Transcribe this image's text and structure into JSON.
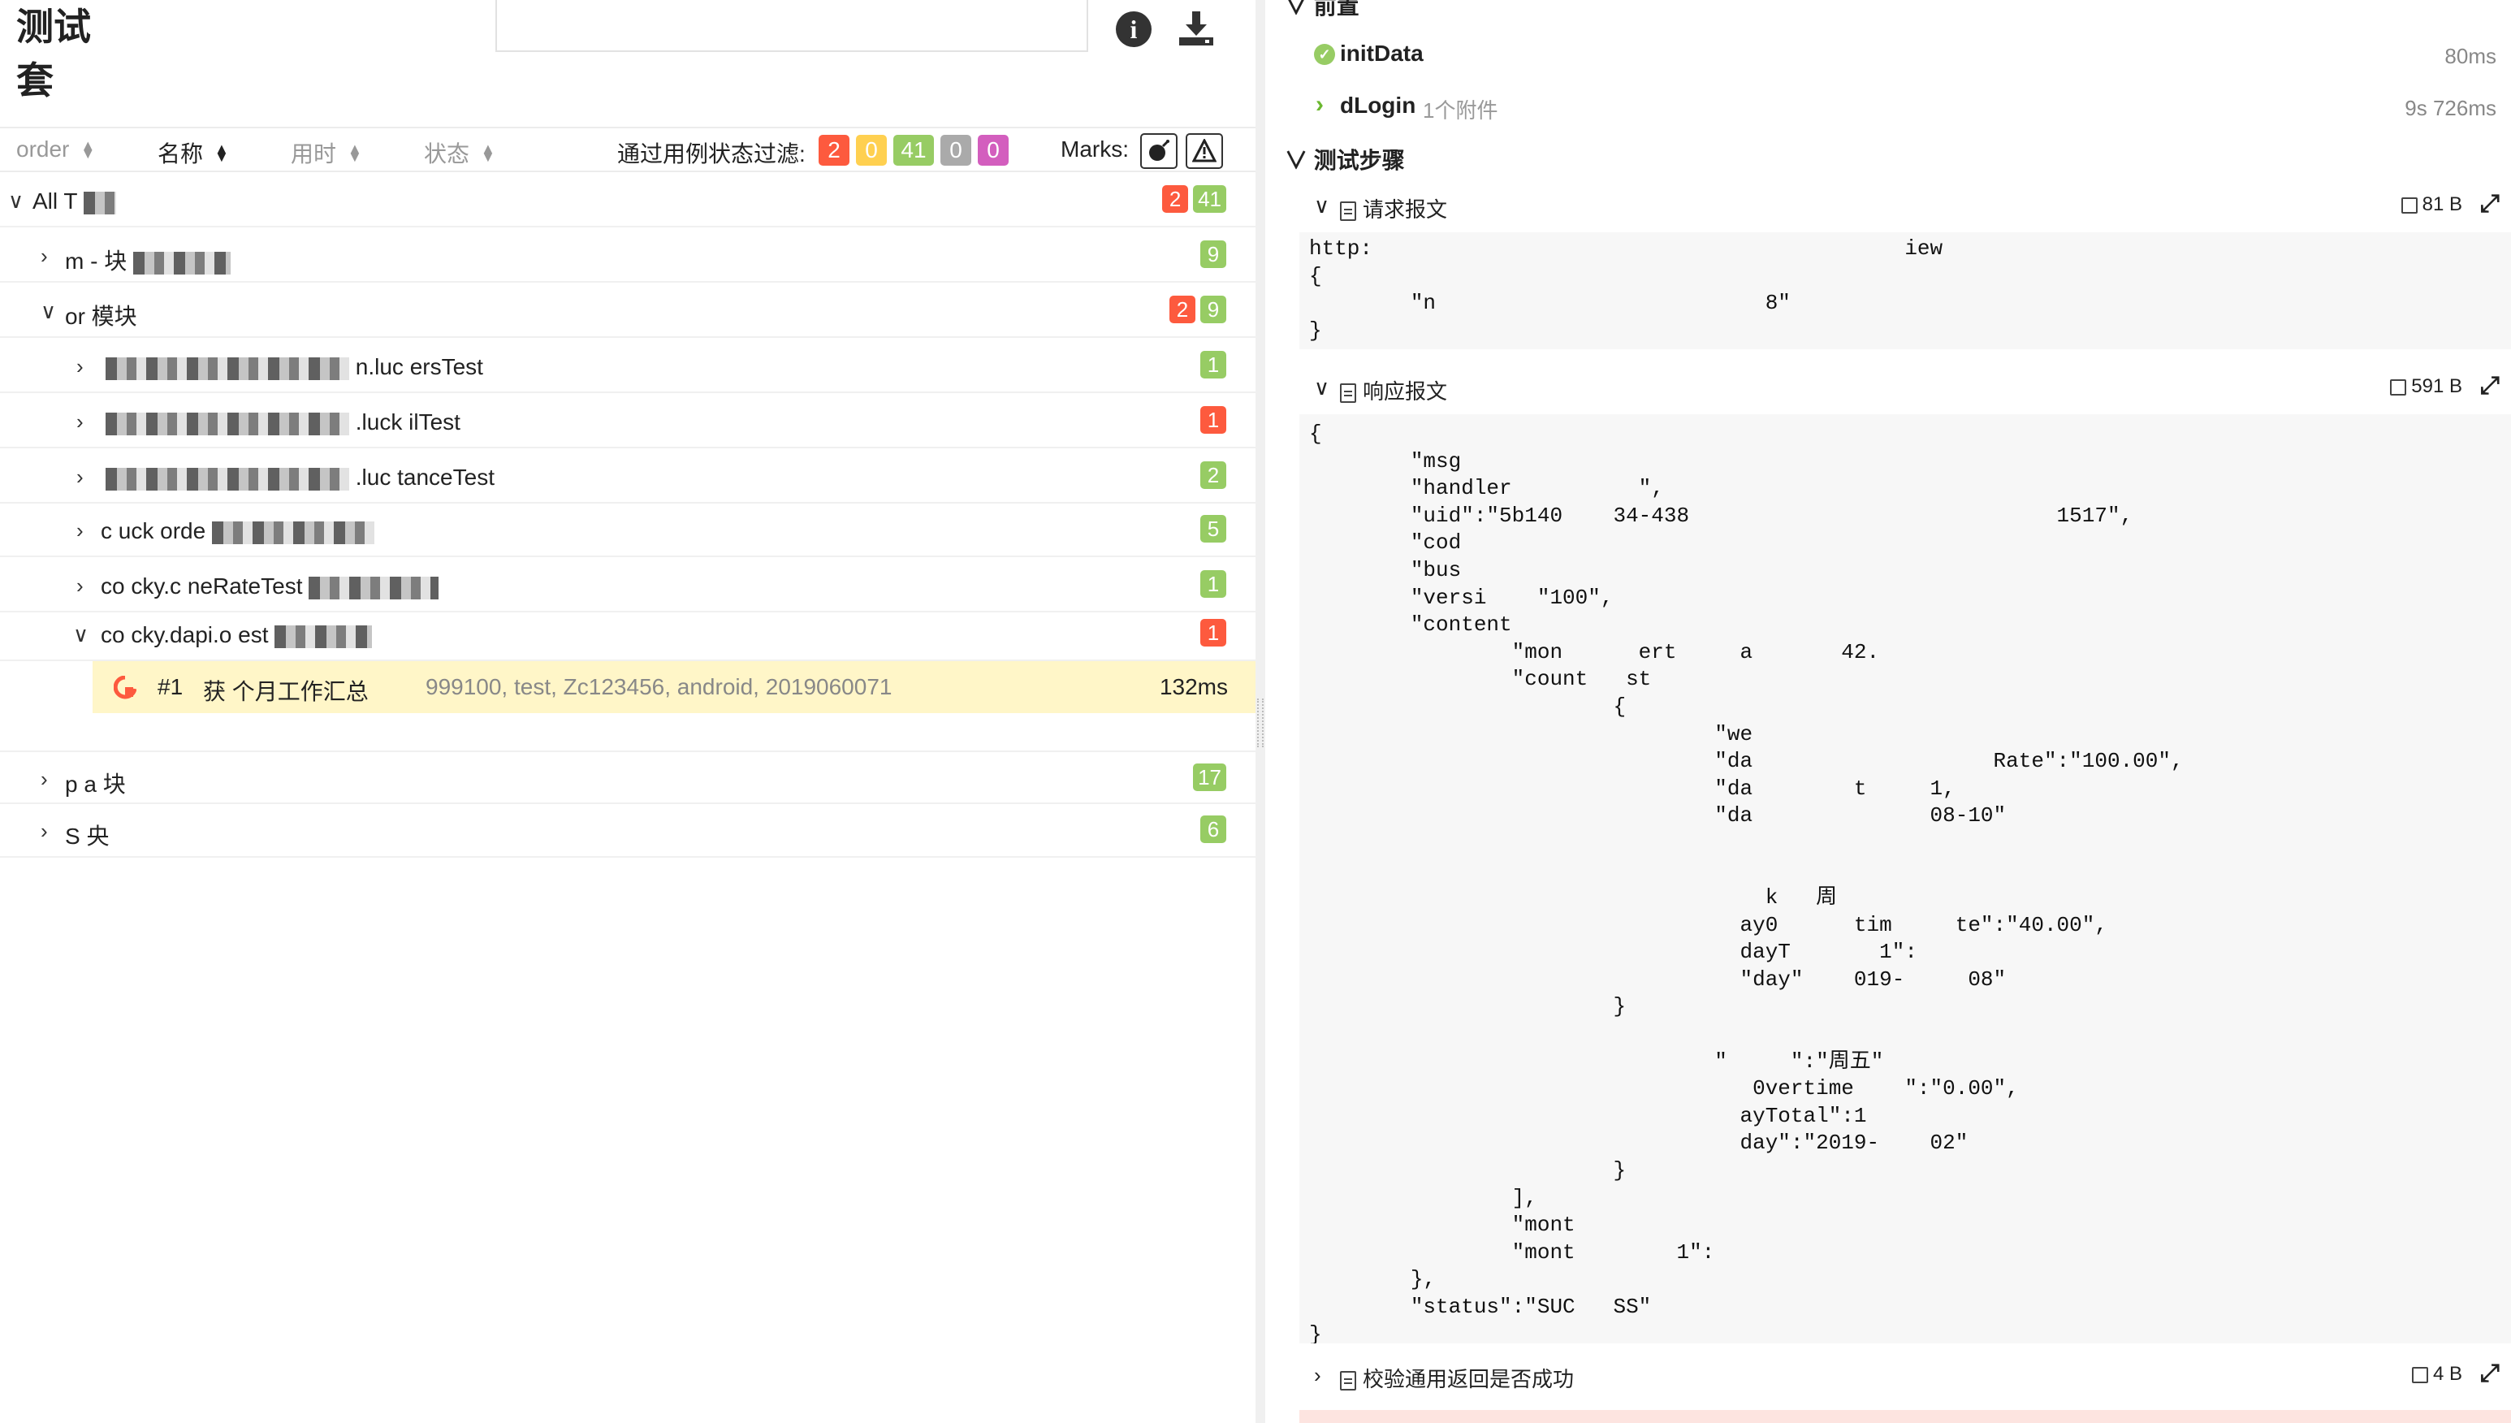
{
  "suite": {
    "title": "测试套",
    "search_value": ""
  },
  "icons": {
    "info": "info-circle-icon",
    "download": "download-icon"
  },
  "sortbar": {
    "columns": [
      "order",
      "名称",
      "用时",
      "状态"
    ],
    "filter_label": "通过用例状态过滤:",
    "filter_counts": [
      "2",
      "0",
      "41",
      "0",
      "0"
    ],
    "filter_colors": [
      "#fd5a3e",
      "#ffd050",
      "#97cc64",
      "#aaaaaa",
      "#d35ebe"
    ],
    "marks_label": "Marks:"
  },
  "tree": {
    "rows": [
      {
        "chev": "∨",
        "label": "All T",
        "red": "2",
        "green": "41"
      },
      {
        "chev": "›",
        "label": "m  -  块",
        "red": "",
        "green": "9"
      },
      {
        "chev": "∨",
        "label": "or  模块",
        "red": "2",
        "green": "9"
      },
      {
        "chev": "›",
        "label": "  n.luc    ersTest",
        "red": "",
        "green": "1"
      },
      {
        "chev": "›",
        "label": "  .luck    ilTest",
        "red": "1",
        "green": ""
      },
      {
        "chev": "›",
        "label": "  .luc    tanceTest",
        "red": "",
        "green": "2"
      },
      {
        "chev": "›",
        "label": "c   uck   orde",
        "red": "",
        "green": "5"
      },
      {
        "chev": "›",
        "label": "co   cky.c    neRateTest",
        "red": "",
        "green": "1"
      },
      {
        "chev": "∨",
        "label": "co   cky.dapi.o    est",
        "red": "1",
        "green": ""
      },
      {
        "chev": "›",
        "label": "p   a   块",
        "red": "",
        "green": "17"
      },
      {
        "chev": "›",
        "label": "S   央",
        "red": "",
        "green": "6"
      }
    ],
    "selected": {
      "num": "#1",
      "name": "获  个月工作汇总",
      "params": "999100, test, Zc123456, android, 2019060071",
      "duration": "132ms"
    }
  },
  "right": {
    "setup_label": "前置",
    "setup_items": [
      {
        "name": "initData",
        "extra": "",
        "time": "80ms"
      },
      {
        "name": "dLogin",
        "extra": "1个附件",
        "time": "9s 726ms"
      }
    ],
    "steps_label": "测试步骤",
    "request": {
      "title": "请求报文",
      "size": "81 B",
      "body": "http:                                          iew\n{\n        \"n                          8\"\n}"
    },
    "response": {
      "title": "响应报文",
      "size": "591 B",
      "body": "{\n        \"msg\n        \"handler          \",\n        \"uid\":\"5b140    34-438                             1517\",\n        \"cod\n        \"bus\n        \"versi    \"100\",\n        \"content\n                \"mon      ert     a       42.\n                \"count   st\n                        {\n                                \"we\n                                \"da                   Rate\":\"100.00\",\n                                \"da        t     1,\n                                \"da              08-10\"\n\n\n                                    k   周\n                                  ay0      tim     te\":\"40.00\",\n                                  dayT       1\":\n                                  \"day\"    019-     08\"\n                        }\n\n                                \"     \":\"周五\"\n                                   0vertime    \":\"0.00\",\n                                  ayTotal\":1\n                                  day\":\"2019-    02\"\n                        }\n                ],\n                \"mont\n                \"mont        1\":\n        },\n        \"status\":\"SUC   SS\"\n}"
    },
    "check": {
      "title": "校验通用返回是否成功",
      "size": "4 B"
    }
  }
}
